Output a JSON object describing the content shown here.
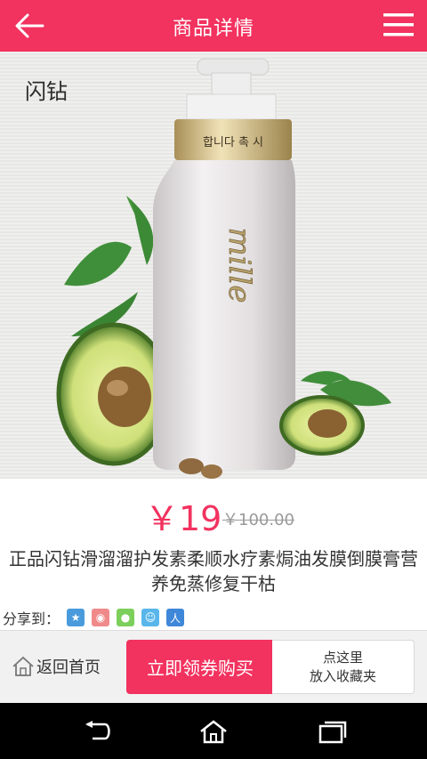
{
  "header": {
    "title": "商品详情",
    "back_icon": "arrow-left-icon",
    "menu_icon": "hamburger-menu-icon"
  },
  "product_image": {
    "brand_label": "闪钻",
    "bottle_text": "mille",
    "cap_text": "합니다 촉 시 "
  },
  "price": {
    "current": "￥19",
    "original": "￥100.00"
  },
  "product": {
    "title": "正品闪钻滑溜溜护发素柔顺水疗素焗油发膜倒膜膏营养免蒸修复干枯"
  },
  "share": {
    "label": "分享到：",
    "icons": [
      "qzone-icon",
      "weibo-icon",
      "wechat-icon",
      "qq-icon",
      "renren-icon"
    ]
  },
  "actions": {
    "home_label": "返回首页",
    "buy_label": "立即领券购买",
    "favorite_line1": "点这里",
    "favorite_line2": "放入收藏夹"
  },
  "colors": {
    "accent": "#f2325f"
  }
}
